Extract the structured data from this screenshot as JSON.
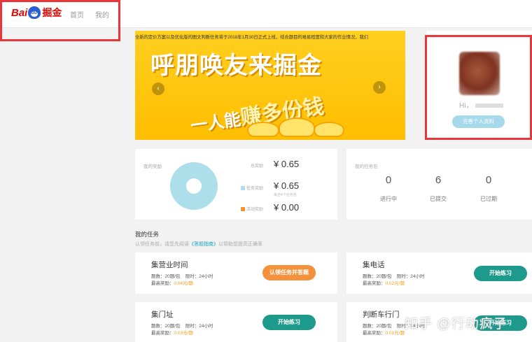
{
  "header": {
    "logo_bai": "Bai",
    "logo_du": "du",
    "logo_jue": "掘金",
    "nav": [
      "首页",
      "我的"
    ]
  },
  "banner": {
    "marquee": "全新的定价方案以及优化版的图文判断任务将于2018年1月30日正式上线，结合题目的难易程度和大家的作业情况，我们",
    "line1": "呼朋唤友来掘金",
    "line2_a": "一人能",
    "line2_b": "赚多份钱",
    "arrow_left": "‹",
    "arrow_right": "›"
  },
  "profile": {
    "greeting": "Hi，",
    "complete_button": "完善个人资料"
  },
  "reward": {
    "title": "我的奖励",
    "total_label": "总奖励",
    "total_value": "¥ 0.65",
    "task_label": "任务奖励",
    "task_value": "¥ 0.65",
    "task_sub": "来自4个任务包",
    "activity_label": "活动奖励",
    "activity_value": "¥ 0.00",
    "colors": {
      "task": "#acdfea",
      "activity": "#f5913a"
    }
  },
  "task_packages": {
    "title": "我的任务包",
    "stats": [
      {
        "value": "0",
        "label": "进行中"
      },
      {
        "value": "6",
        "label": "已提交"
      },
      {
        "value": "0",
        "label": "已过期"
      }
    ]
  },
  "my_tasks": {
    "title": "我的任务",
    "tip_before": "认领任务前，请您先阅读",
    "tip_link": "《答题指南》",
    "tip_after": "以帮助您提高正确率",
    "tasks": [
      {
        "name": "集营业时间",
        "count": "题数：20题/包",
        "limit": "限时：24小时",
        "reward_label": "最高奖励：",
        "reward": "0.04元/题",
        "button": "认领任务并答题"
      },
      {
        "name": "集电话",
        "count": "题数：20题/包",
        "limit": "限时：24小时",
        "reward_label": "最高奖励：",
        "reward": "0.02元/题",
        "button": "开始练习"
      },
      {
        "name": "集门址",
        "count": "题数：20题/包",
        "limit": "限时：24小时",
        "reward_label": "最高奖励：",
        "reward": "0.03元/题",
        "button": "开始练习"
      },
      {
        "name": "判断车行门",
        "count": "题数：20题/包",
        "limit": "限时：24小时",
        "reward_label": "最高奖励：",
        "reward": "0.01元/题",
        "button": "开始练习"
      }
    ]
  },
  "watermark": "知乎 @行动疯子"
}
